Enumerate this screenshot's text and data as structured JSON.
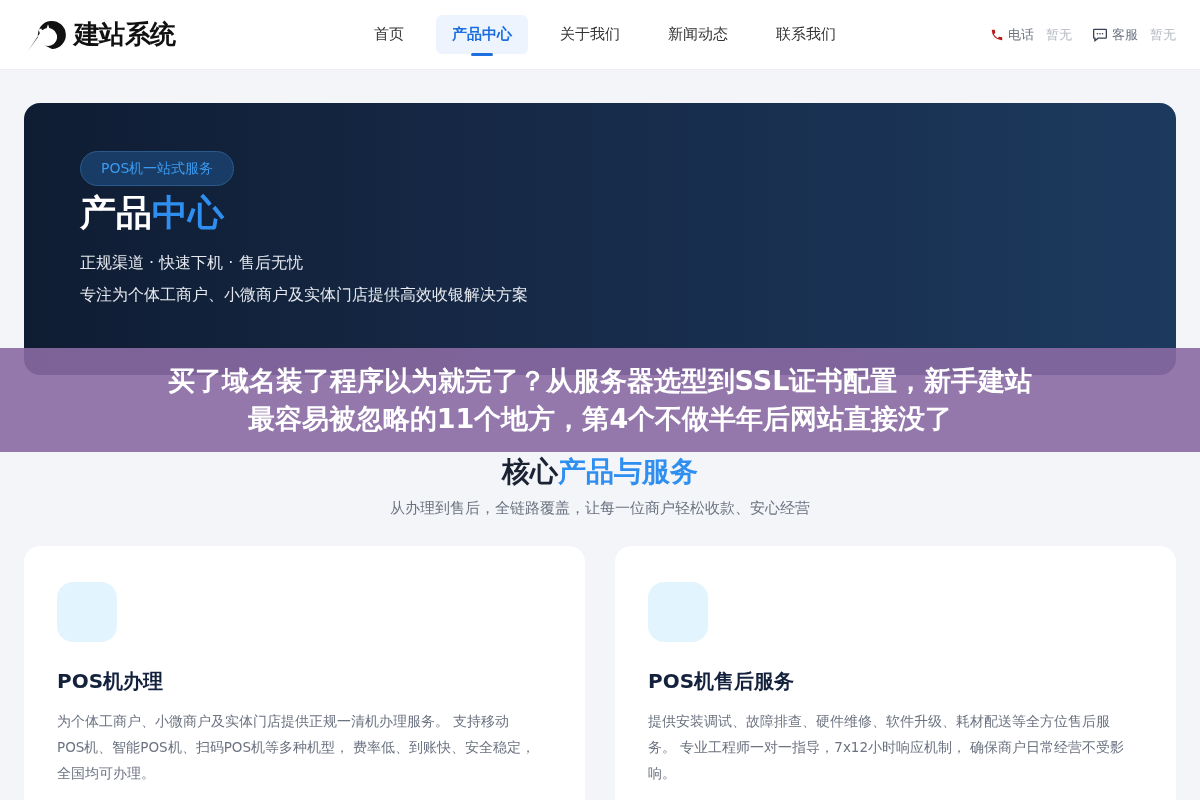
{
  "header": {
    "logo": "建站系统",
    "nav": [
      {
        "label": "首页",
        "selected": false
      },
      {
        "label": "产品中心",
        "selected": true
      },
      {
        "label": "关于我们",
        "selected": false
      },
      {
        "label": "新闻动态",
        "selected": false
      },
      {
        "label": "联系我们",
        "selected": false
      }
    ],
    "contacts": [
      {
        "kind": "phone",
        "label": "电话",
        "value": "暂无"
      },
      {
        "kind": "chat",
        "label": "客服",
        "value": "暂无"
      }
    ]
  },
  "hero": {
    "badge": "POS机一站式服务",
    "title_white": "产品",
    "title_blue": "中心",
    "tagline": "正规渠道 · 快速下机 · 售后无忧",
    "description": "专注为个体工商户、小微商户及实体门店提供高效收银解决方案"
  },
  "banner": {
    "lines": [
      "买了域名装了程序以为就完了？从服务器选型到SSL证书配置，新手建站",
      "最容易被忽略的11个地方，第4个不做半年后网站直接没了"
    ]
  },
  "section": {
    "title_dark": "核心",
    "title_blue": "产品与服务",
    "subtitle": "从办理到售后，全链路覆盖，让每一位商户轻松收款、安心经营"
  },
  "cards": [
    {
      "title": "POS机办理",
      "description": "为个体工商户、小微商户及实体门店提供正规一清机办理服务。 支持移动POS机、智能POS机、扫码POS机等多种机型， 费率低、到账快、安全稳定，全国均可办理。"
    },
    {
      "title": "POS机售后服务",
      "description": "提供安装调试、故障排查、硬件维修、软件升级、耗材配送等全方位售后服务。 专业工程师一对一指导，7x12小时响应机制， 确保商户日常经营不受影响。"
    }
  ]
}
